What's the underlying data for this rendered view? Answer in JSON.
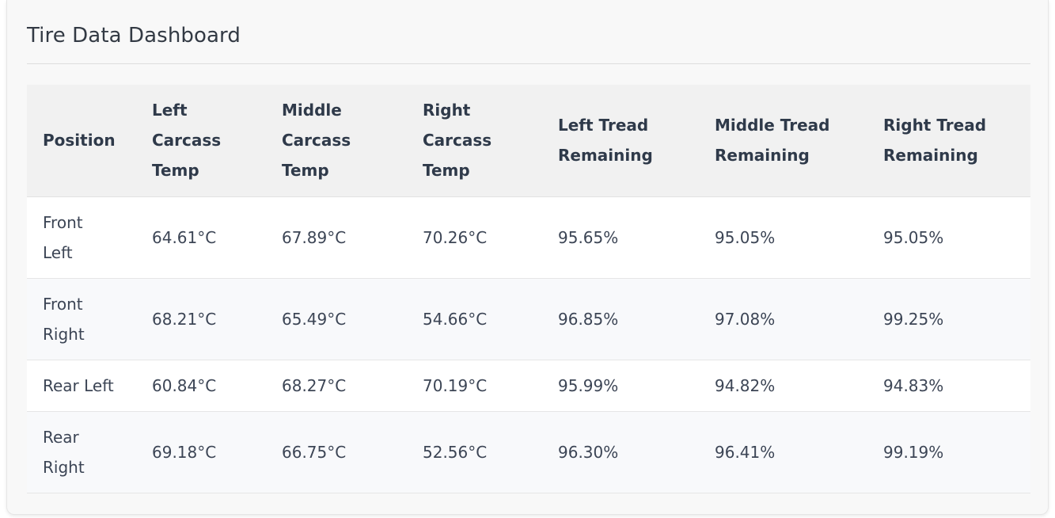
{
  "header": {
    "title": "Tire Data Dashboard"
  },
  "table": {
    "columns": [
      "Position",
      "Left Carcass Temp",
      "Middle Carcass Temp",
      "Right Carcass Temp",
      "Left Tread Remaining",
      "Middle Tread Remaining",
      "Right Tread Remaining"
    ],
    "rows": [
      [
        "Front Left",
        "64.61°C",
        "67.89°C",
        "70.26°C",
        "95.65%",
        "95.05%",
        "95.05%"
      ],
      [
        "Front Right",
        "68.21°C",
        "65.49°C",
        "54.66°C",
        "96.85%",
        "97.08%",
        "99.25%"
      ],
      [
        "Rear Left",
        "60.84°C",
        "68.27°C",
        "70.19°C",
        "95.99%",
        "94.82%",
        "94.83%"
      ],
      [
        "Rear Right",
        "69.18°C",
        "66.75°C",
        "52.56°C",
        "96.30%",
        "96.41%",
        "99.19%"
      ]
    ]
  },
  "colors": {
    "card_background": "#f8f8f8",
    "header_row_background": "#f1f1f1",
    "row_odd": "#ffffff",
    "row_even": "#f8f9fb",
    "text": "#3c4555"
  }
}
